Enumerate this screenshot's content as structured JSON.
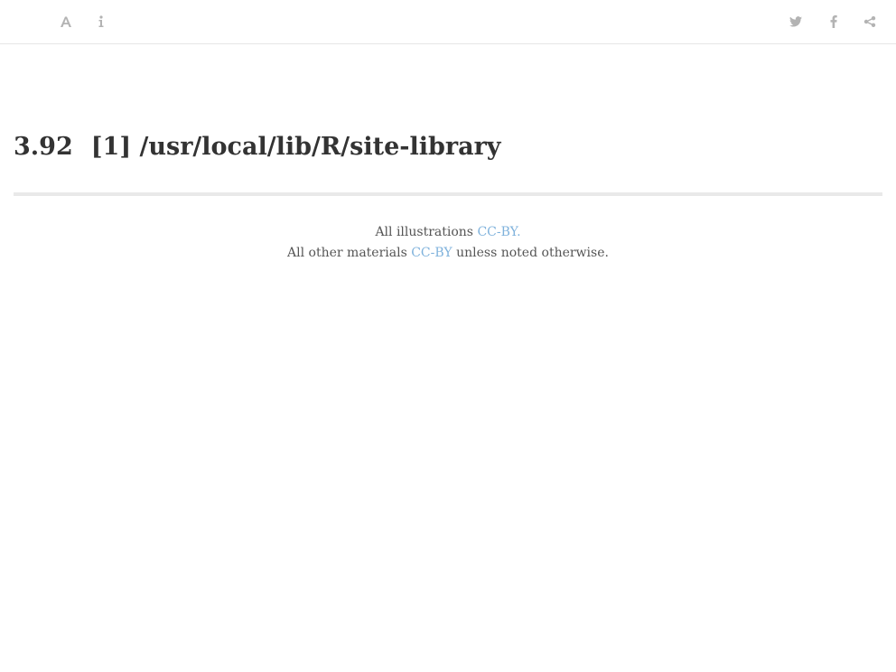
{
  "toolbar": {
    "left_icons": [
      "font-settings-icon",
      "info-icon"
    ],
    "right_icons": [
      "twitter-icon",
      "facebook-icon",
      "share-icon"
    ]
  },
  "heading": {
    "section_number": "3.92",
    "title": "[1] /usr/local/lib/R/site-library"
  },
  "license": {
    "line1_prefix": "All illustrations",
    "line1_link": "CC-BY.",
    "line2_prefix": "All other materials",
    "line2_link": "CC-BY",
    "line2_suffix": "unless noted otherwise."
  },
  "colors": {
    "icon": "#b3b3b3",
    "link": "#7fb2dc",
    "text": "#333333",
    "rule": "#e9e9e9"
  }
}
